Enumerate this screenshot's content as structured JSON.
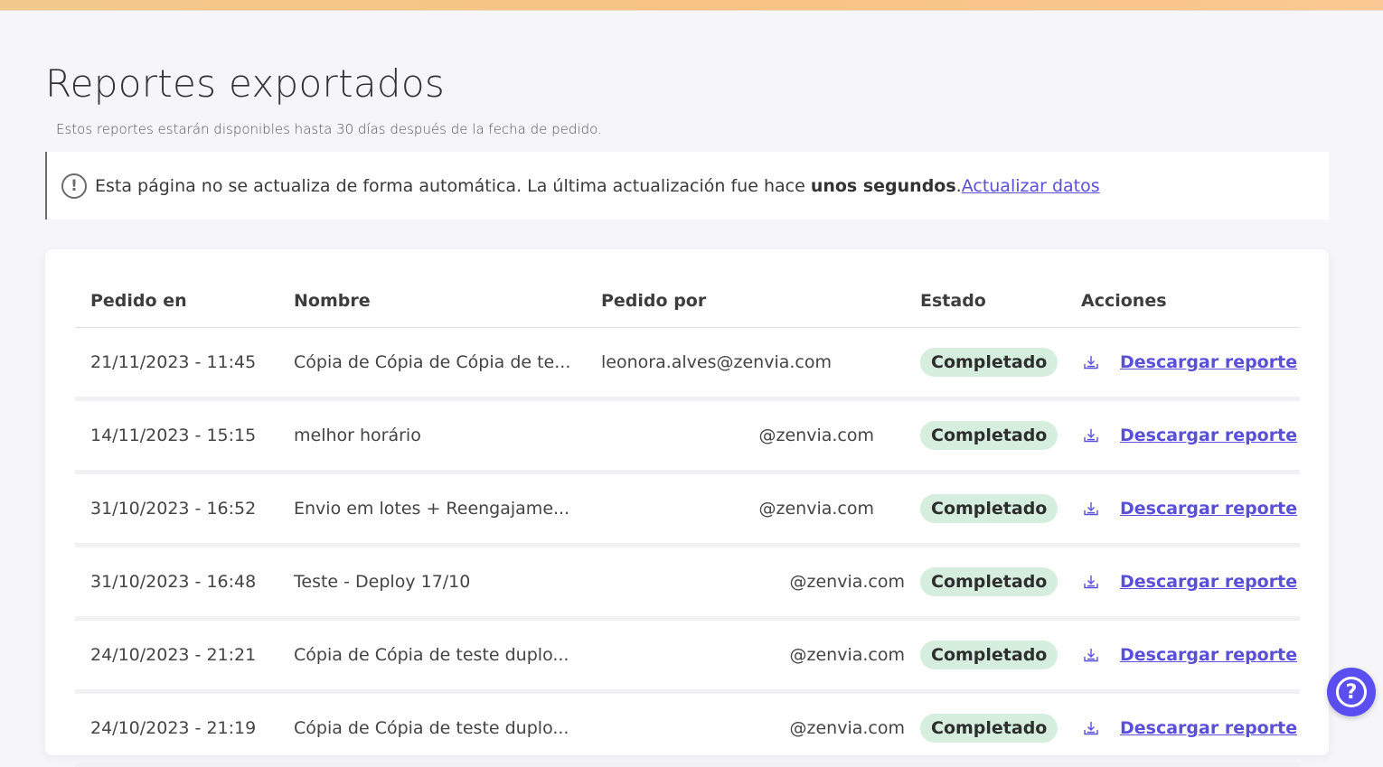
{
  "page": {
    "title": "Reportes exportados",
    "subtitle": "Estos reportes estarán disponibles hasta 30 días después de la fecha de pedido."
  },
  "notice": {
    "icon": "info-icon",
    "text_before": "Esta página no se actualiza de forma automática. La última actualización fue hace ",
    "bold_text": "unos segundos",
    "text_after": ".",
    "link_text": " Actualizar datos"
  },
  "table": {
    "headers": {
      "requested_at": "Pedido en",
      "name": "Nombre",
      "requested_by": "Pedido por",
      "status": "Estado",
      "actions": "Acciones"
    },
    "rows": [
      {
        "requested_at": "21/11/2023 - 11:45",
        "name": "Cópia de Cópia de Cópia de te...",
        "requested_by": "leonora.alves@zenvia.com",
        "status": "Completado",
        "action": "Descargar reporte"
      },
      {
        "requested_at": "14/11/2023 - 15:15",
        "name": "melhor horário",
        "requested_by": "@zenvia.com",
        "status": "Completado",
        "action": "Descargar reporte"
      },
      {
        "requested_at": "31/10/2023 - 16:52",
        "name": "Envio em lotes + Reengajame...",
        "requested_by": "@zenvia.com",
        "status": "Completado",
        "action": "Descargar reporte"
      },
      {
        "requested_at": "31/10/2023 - 16:48",
        "name": "Teste - Deploy 17/10",
        "requested_by": "@zenvia.com",
        "status": "Completado",
        "action": "Descargar reporte"
      },
      {
        "requested_at": "24/10/2023 - 21:21",
        "name": "Cópia de Cópia de teste duplo...",
        "requested_by": "@zenvia.com",
        "status": "Completado",
        "action": "Descargar reporte"
      },
      {
        "requested_at": "24/10/2023 - 21:19",
        "name": "Cópia de Cópia de teste duplo...",
        "requested_by": "@zenvia.com",
        "status": "Completado",
        "action": "Descargar reporte"
      }
    ]
  },
  "help_button": {
    "icon": "help-icon",
    "label": "?"
  },
  "colors": {
    "accent": "#5a4fd8",
    "status_completed_bg": "#d5eedd",
    "help_bg": "#5b4ef0",
    "top_bar": "#f7c383"
  }
}
